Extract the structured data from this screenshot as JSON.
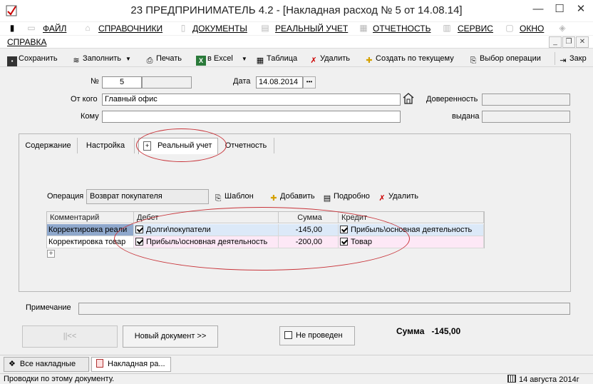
{
  "window": {
    "title": "23  ПРЕДПРИНИМАТЕЛЬ 4.2 - [Накладная расход № 5 от 14.08.14]",
    "minimize": "—",
    "maximize": "☐",
    "close": "✕"
  },
  "menu": {
    "items": [
      "ФАЙЛ",
      "СПРАВОЧНИКИ",
      "ДОКУМЕНТЫ",
      "РЕАЛЬНЫЙ УЧЕТ",
      "ОТЧЕТНОСТЬ",
      "СЕРВИС",
      "ОКНО",
      "СПРАВКА"
    ]
  },
  "toolbar": {
    "save": "Сохранить",
    "fill": "Заполнить",
    "print": "Печать",
    "excel": "в Excel",
    "table": "Таблица",
    "delete": "Удалить",
    "create_based": "Создать по текущему",
    "choose_operation": "Выбор операции",
    "close": "Закр"
  },
  "form": {
    "number_label": "№",
    "number_value": "5",
    "date_label": "Дата",
    "date_value": "14.08.2014",
    "date_btn": "•••",
    "from_label": "От кого",
    "from_value": "Главный офис",
    "to_label": "Кому",
    "to_value": "",
    "trust_label": "Доверенность",
    "issued_label": "выдана"
  },
  "tabs": [
    "Содержание",
    "Настройка",
    "Реальный учет",
    "Отчетность"
  ],
  "operation": {
    "label": "Операция",
    "value": "Возврат покупателя",
    "template": "Шаблон",
    "add": "Добавить",
    "details": "Подробно",
    "delete": "Удалить"
  },
  "grid": {
    "headers": [
      "Комментарий",
      "Дебет",
      "Сумма",
      "Кредит"
    ],
    "rows": [
      {
        "comment": "Корректировка реали",
        "debit": "Долги\\покупатели",
        "sum": "-145,00",
        "credit": "Прибыль\\основная деятельность"
      },
      {
        "comment": "Корректировка товар",
        "debit": "Прибыль\\основная деятельность",
        "sum": "-200,00",
        "credit": "Товар"
      }
    ],
    "add_row": "+"
  },
  "note_label": "Примечание",
  "buttons": {
    "first": "||<<",
    "new_doc": "Новый документ >>",
    "not_posted": "Не проведен"
  },
  "total": {
    "label": "Сумма",
    "value": "-145,00"
  },
  "doc_tabs": [
    "Все накладные",
    "Накладная ра..."
  ],
  "status": {
    "left": "Проводки по этому документу.",
    "right": "14 августа 2014г"
  },
  "colors": {
    "selected_row": "#dce9f8",
    "selected_comment": "#8fa8cc",
    "row2": "#fde8f6",
    "annotation": "#c8343a"
  }
}
